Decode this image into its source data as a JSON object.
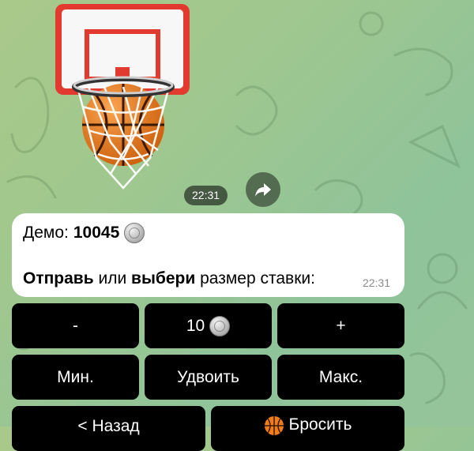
{
  "sticker": {
    "time": "22:31"
  },
  "message": {
    "demo_label": "Демо:",
    "demo_amount": "10045",
    "prompt_bold1": "Отправь",
    "prompt_mid": " или ",
    "prompt_bold2": "выбери",
    "prompt_rest": " размер ставки:",
    "time": "22:31"
  },
  "keyboard": {
    "minus": "-",
    "bet": "10",
    "plus": "+",
    "min": "Мин.",
    "double": "Удвоить",
    "max": "Макс.",
    "back": "< Назад",
    "throw": "Бросить"
  },
  "icons": {
    "coin": "coin-icon",
    "share": "share-arrow-icon",
    "ball": "basketball-icon"
  },
  "colors": {
    "button_bg": "#000000",
    "bubble_bg": "#ffffff",
    "hoop_red": "#e33a2f",
    "ball_orange": "#f07d1a"
  }
}
